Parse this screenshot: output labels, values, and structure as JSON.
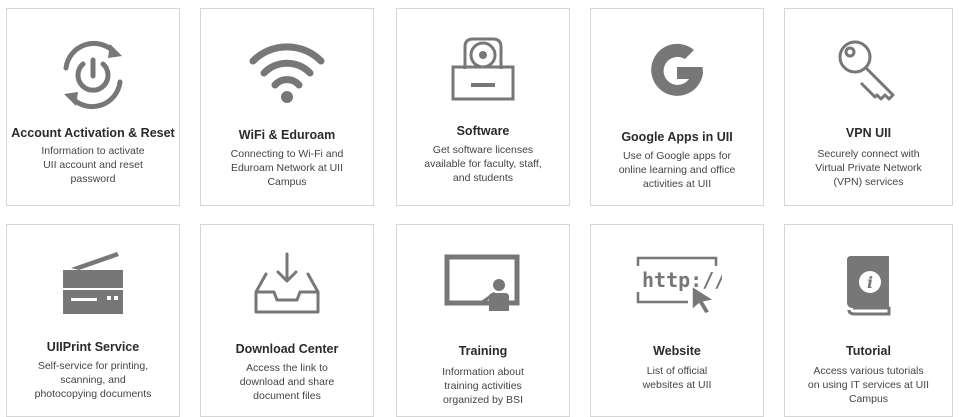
{
  "colors": {
    "icon": "#777777",
    "card_border": "#d6d6d6",
    "title": "#2b2b2b",
    "desc": "#444444"
  },
  "cards": [
    {
      "icon": "power-refresh-icon",
      "title": "Account Activation & Reset",
      "desc": [
        "Information to activate",
        "UII account and reset",
        "password"
      ]
    },
    {
      "icon": "wifi-icon",
      "title": "WiFi & Eduroam",
      "desc": [
        "Connecting to Wi-Fi and",
        "Eduroam Network at UII",
        "Campus"
      ]
    },
    {
      "icon": "software-disc-icon",
      "title": "Software",
      "desc": [
        "Get software licenses",
        "available for faculty, staff,",
        "and students"
      ]
    },
    {
      "icon": "google-icon",
      "title": "Google Apps in UII",
      "desc": [
        "Use of Google apps for",
        "online learning and office",
        "activities at UII"
      ]
    },
    {
      "icon": "key-icon",
      "title": "VPN UII",
      "desc": [
        "Securely connect with",
        "Virtual Private Network",
        "(VPN) services"
      ]
    },
    {
      "icon": "printer-icon",
      "title": "UIIPrint Service",
      "desc": [
        "Self-service for printing,",
        "scanning, and",
        "photocopying documents"
      ]
    },
    {
      "icon": "download-tray-icon",
      "title": "Download Center",
      "desc": [
        "Access the link to",
        "download and share",
        "document files"
      ]
    },
    {
      "icon": "presentation-board-icon",
      "title": "Training",
      "desc": [
        "Information about",
        "training activities",
        "organized by BSI"
      ]
    },
    {
      "icon": "http-cursor-icon",
      "title": "Website",
      "desc": [
        "List of official",
        "websites at UII"
      ],
      "icon_text": "http://"
    },
    {
      "icon": "info-book-icon",
      "title": "Tutorial",
      "desc": [
        "Access various tutorials",
        "on using IT services at UII",
        "Campus"
      ]
    }
  ]
}
